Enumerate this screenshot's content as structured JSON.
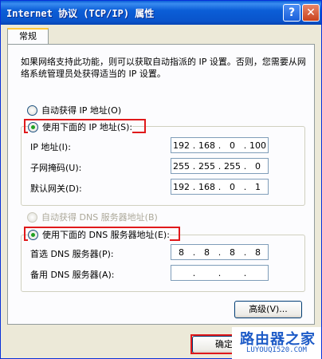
{
  "window": {
    "title": "Internet 协议 (TCP/IP) 属性",
    "help_label": "?",
    "close_label": "✕"
  },
  "tabs": [
    "常规"
  ],
  "description": "如果网络支持此功能，则可以获取自动指派的 IP 设置。否则，您需要从网络系统管理员处获得适当的 IP 设置。",
  "ip_section": {
    "auto_label": "自动获得 IP 地址(O)",
    "manual_label": "使用下面的 IP 地址(S):",
    "selected": "manual",
    "fields": [
      {
        "label": "IP 地址(I):",
        "octets": [
          "192",
          "168",
          "0",
          "100"
        ]
      },
      {
        "label": "子网掩码(U):",
        "octets": [
          "255",
          "255",
          "255",
          "0"
        ]
      },
      {
        "label": "默认网关(D):",
        "octets": [
          "192",
          "168",
          "0",
          "1"
        ]
      }
    ]
  },
  "dns_section": {
    "auto_label": "自动获得 DNS 服务器地址(B)",
    "manual_label": "使用下面的 DNS 服务器地址(E):",
    "selected": "manual",
    "fields": [
      {
        "label": "首选 DNS 服务器(P):",
        "octets": [
          "8",
          "8",
          "8",
          "8"
        ]
      },
      {
        "label": "备用 DNS 服务器(A):",
        "octets": [
          "",
          "",
          "",
          ""
        ]
      }
    ]
  },
  "buttons": {
    "advanced": "高级(V)...",
    "ok": "确定"
  },
  "watermark": {
    "brand": "路由器之家",
    "url": "LUYOUQI520.COM"
  },
  "colors": {
    "titlebar": "#0a54cb",
    "highlight": "#e0191b",
    "radio_selected": "#21a121",
    "watermark": "#1d5bc7"
  }
}
